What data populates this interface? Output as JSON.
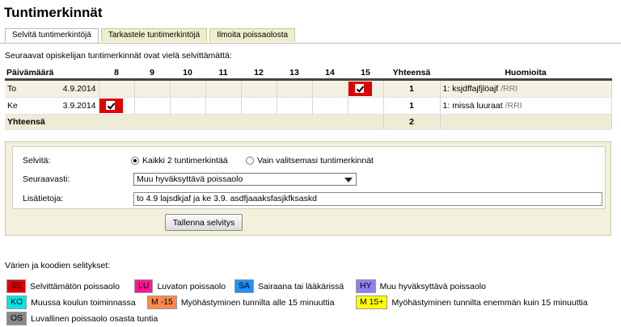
{
  "page": {
    "title": "Tuntimerkinnät"
  },
  "tabs": [
    "Selvitä tuntimerkintöjä",
    "Tarkastele tuntimerkintöjä",
    "Ilmoita poissaolosta"
  ],
  "intro_text": "Seuraavat opiskelijan tuntimerkinnät ovat vielä selvittämättä:",
  "table": {
    "headers": [
      "Päivämäärä",
      "8",
      "9",
      "10",
      "11",
      "12",
      "13",
      "14",
      "15",
      "Yhteensä",
      "Huomioita"
    ],
    "rows": [
      {
        "day": "To",
        "date": "4.9.2014",
        "marked_hour": "15",
        "mark_small": "1",
        "total": "1",
        "note": "1: ksjdffajfjlöajf",
        "note_src": "/RRI"
      },
      {
        "day": "Ke",
        "date": "3.9.2014",
        "marked_hour": "8",
        "total": "1",
        "note": "1: missä luuraat",
        "note_src": "/RRI"
      }
    ],
    "total_label": "Yhteensä",
    "total_value": "2"
  },
  "form": {
    "selvita_label": "Selvitä:",
    "radio_all": "Kaikki 2 tuntimerkintää",
    "radio_selected": "Vain valitsemasi tuntimerkinnät",
    "radio_value": "all",
    "seuraavasti_label": "Seuraavasti:",
    "seuraavasti_value": "Muu hyväksyttävä poissaolo",
    "lisatietoja_label": "Lisätietoja:",
    "lisatietoja_value": "to 4.9 lajsdkjaf ja ke 3.9. asdfjaaaksfasjkfksaskd",
    "save_label": "Tallenna selvitys"
  },
  "legend": {
    "title": "Värien ja koodien selitykset:",
    "items": [
      {
        "code": "SE",
        "label": "Selvittämätön poissaolo",
        "color": "#e00000",
        "text_color": "#000000"
      },
      {
        "code": "LU",
        "label": "Luvaton poissaolo",
        "color": "#ff1493",
        "text_color": "#000000"
      },
      {
        "code": "SA",
        "label": "Sairaana tai lääkärissä",
        "color": "#1e90ff",
        "text_color": "#000000"
      },
      {
        "code": "HY",
        "label": "Muu hyväksyttävä poissaolo",
        "color": "#8c82f0",
        "text_color": "#000000"
      },
      {
        "code": "KO",
        "label": "Muussa koulun toiminnassa",
        "color": "#00e6e6",
        "text_color": "#000000"
      },
      {
        "code": "M -15",
        "label": "Myöhästyminen tunnilta alle 15 minuuttia",
        "color": "#ff8a4c",
        "text_color": "#000000"
      },
      {
        "code": "M 15+",
        "label": "Myöhästyminen tunnilta enemmän kuin 15 minuuttia",
        "color": "#ffff00",
        "text_color": "#000000"
      },
      {
        "code": "OS",
        "label": "Luvallinen poissaolo osasta tuntia",
        "color": "#888888",
        "text_color": "#000000"
      }
    ]
  }
}
